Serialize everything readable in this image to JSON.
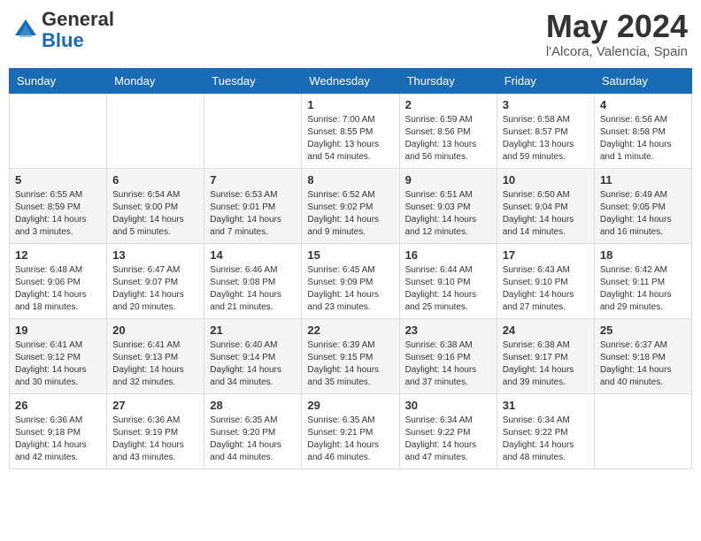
{
  "header": {
    "logo_general": "General",
    "logo_blue": "Blue",
    "month_year": "May 2024",
    "location": "l'Alcora, Valencia, Spain"
  },
  "days_of_week": [
    "Sunday",
    "Monday",
    "Tuesday",
    "Wednesday",
    "Thursday",
    "Friday",
    "Saturday"
  ],
  "weeks": [
    [
      {
        "day": "",
        "sunrise": "",
        "sunset": "",
        "daylight": ""
      },
      {
        "day": "",
        "sunrise": "",
        "sunset": "",
        "daylight": ""
      },
      {
        "day": "",
        "sunrise": "",
        "sunset": "",
        "daylight": ""
      },
      {
        "day": "1",
        "sunrise": "Sunrise: 7:00 AM",
        "sunset": "Sunset: 8:55 PM",
        "daylight": "Daylight: 13 hours and 54 minutes."
      },
      {
        "day": "2",
        "sunrise": "Sunrise: 6:59 AM",
        "sunset": "Sunset: 8:56 PM",
        "daylight": "Daylight: 13 hours and 56 minutes."
      },
      {
        "day": "3",
        "sunrise": "Sunrise: 6:58 AM",
        "sunset": "Sunset: 8:57 PM",
        "daylight": "Daylight: 13 hours and 59 minutes."
      },
      {
        "day": "4",
        "sunrise": "Sunrise: 6:56 AM",
        "sunset": "Sunset: 8:58 PM",
        "daylight": "Daylight: 14 hours and 1 minute."
      }
    ],
    [
      {
        "day": "5",
        "sunrise": "Sunrise: 6:55 AM",
        "sunset": "Sunset: 8:59 PM",
        "daylight": "Daylight: 14 hours and 3 minutes."
      },
      {
        "day": "6",
        "sunrise": "Sunrise: 6:54 AM",
        "sunset": "Sunset: 9:00 PM",
        "daylight": "Daylight: 14 hours and 5 minutes."
      },
      {
        "day": "7",
        "sunrise": "Sunrise: 6:53 AM",
        "sunset": "Sunset: 9:01 PM",
        "daylight": "Daylight: 14 hours and 7 minutes."
      },
      {
        "day": "8",
        "sunrise": "Sunrise: 6:52 AM",
        "sunset": "Sunset: 9:02 PM",
        "daylight": "Daylight: 14 hours and 9 minutes."
      },
      {
        "day": "9",
        "sunrise": "Sunrise: 6:51 AM",
        "sunset": "Sunset: 9:03 PM",
        "daylight": "Daylight: 14 hours and 12 minutes."
      },
      {
        "day": "10",
        "sunrise": "Sunrise: 6:50 AM",
        "sunset": "Sunset: 9:04 PM",
        "daylight": "Daylight: 14 hours and 14 minutes."
      },
      {
        "day": "11",
        "sunrise": "Sunrise: 6:49 AM",
        "sunset": "Sunset: 9:05 PM",
        "daylight": "Daylight: 14 hours and 16 minutes."
      }
    ],
    [
      {
        "day": "12",
        "sunrise": "Sunrise: 6:48 AM",
        "sunset": "Sunset: 9:06 PM",
        "daylight": "Daylight: 14 hours and 18 minutes."
      },
      {
        "day": "13",
        "sunrise": "Sunrise: 6:47 AM",
        "sunset": "Sunset: 9:07 PM",
        "daylight": "Daylight: 14 hours and 20 minutes."
      },
      {
        "day": "14",
        "sunrise": "Sunrise: 6:46 AM",
        "sunset": "Sunset: 9:08 PM",
        "daylight": "Daylight: 14 hours and 21 minutes."
      },
      {
        "day": "15",
        "sunrise": "Sunrise: 6:45 AM",
        "sunset": "Sunset: 9:09 PM",
        "daylight": "Daylight: 14 hours and 23 minutes."
      },
      {
        "day": "16",
        "sunrise": "Sunrise: 6:44 AM",
        "sunset": "Sunset: 9:10 PM",
        "daylight": "Daylight: 14 hours and 25 minutes."
      },
      {
        "day": "17",
        "sunrise": "Sunrise: 6:43 AM",
        "sunset": "Sunset: 9:10 PM",
        "daylight": "Daylight: 14 hours and 27 minutes."
      },
      {
        "day": "18",
        "sunrise": "Sunrise: 6:42 AM",
        "sunset": "Sunset: 9:11 PM",
        "daylight": "Daylight: 14 hours and 29 minutes."
      }
    ],
    [
      {
        "day": "19",
        "sunrise": "Sunrise: 6:41 AM",
        "sunset": "Sunset: 9:12 PM",
        "daylight": "Daylight: 14 hours and 30 minutes."
      },
      {
        "day": "20",
        "sunrise": "Sunrise: 6:41 AM",
        "sunset": "Sunset: 9:13 PM",
        "daylight": "Daylight: 14 hours and 32 minutes."
      },
      {
        "day": "21",
        "sunrise": "Sunrise: 6:40 AM",
        "sunset": "Sunset: 9:14 PM",
        "daylight": "Daylight: 14 hours and 34 minutes."
      },
      {
        "day": "22",
        "sunrise": "Sunrise: 6:39 AM",
        "sunset": "Sunset: 9:15 PM",
        "daylight": "Daylight: 14 hours and 35 minutes."
      },
      {
        "day": "23",
        "sunrise": "Sunrise: 6:38 AM",
        "sunset": "Sunset: 9:16 PM",
        "daylight": "Daylight: 14 hours and 37 minutes."
      },
      {
        "day": "24",
        "sunrise": "Sunrise: 6:38 AM",
        "sunset": "Sunset: 9:17 PM",
        "daylight": "Daylight: 14 hours and 39 minutes."
      },
      {
        "day": "25",
        "sunrise": "Sunrise: 6:37 AM",
        "sunset": "Sunset: 9:18 PM",
        "daylight": "Daylight: 14 hours and 40 minutes."
      }
    ],
    [
      {
        "day": "26",
        "sunrise": "Sunrise: 6:36 AM",
        "sunset": "Sunset: 9:18 PM",
        "daylight": "Daylight: 14 hours and 42 minutes."
      },
      {
        "day": "27",
        "sunrise": "Sunrise: 6:36 AM",
        "sunset": "Sunset: 9:19 PM",
        "daylight": "Daylight: 14 hours and 43 minutes."
      },
      {
        "day": "28",
        "sunrise": "Sunrise: 6:35 AM",
        "sunset": "Sunset: 9:20 PM",
        "daylight": "Daylight: 14 hours and 44 minutes."
      },
      {
        "day": "29",
        "sunrise": "Sunrise: 6:35 AM",
        "sunset": "Sunset: 9:21 PM",
        "daylight": "Daylight: 14 hours and 46 minutes."
      },
      {
        "day": "30",
        "sunrise": "Sunrise: 6:34 AM",
        "sunset": "Sunset: 9:22 PM",
        "daylight": "Daylight: 14 hours and 47 minutes."
      },
      {
        "day": "31",
        "sunrise": "Sunrise: 6:34 AM",
        "sunset": "Sunset: 9:22 PM",
        "daylight": "Daylight: 14 hours and 48 minutes."
      },
      {
        "day": "",
        "sunrise": "",
        "sunset": "",
        "daylight": ""
      }
    ]
  ]
}
